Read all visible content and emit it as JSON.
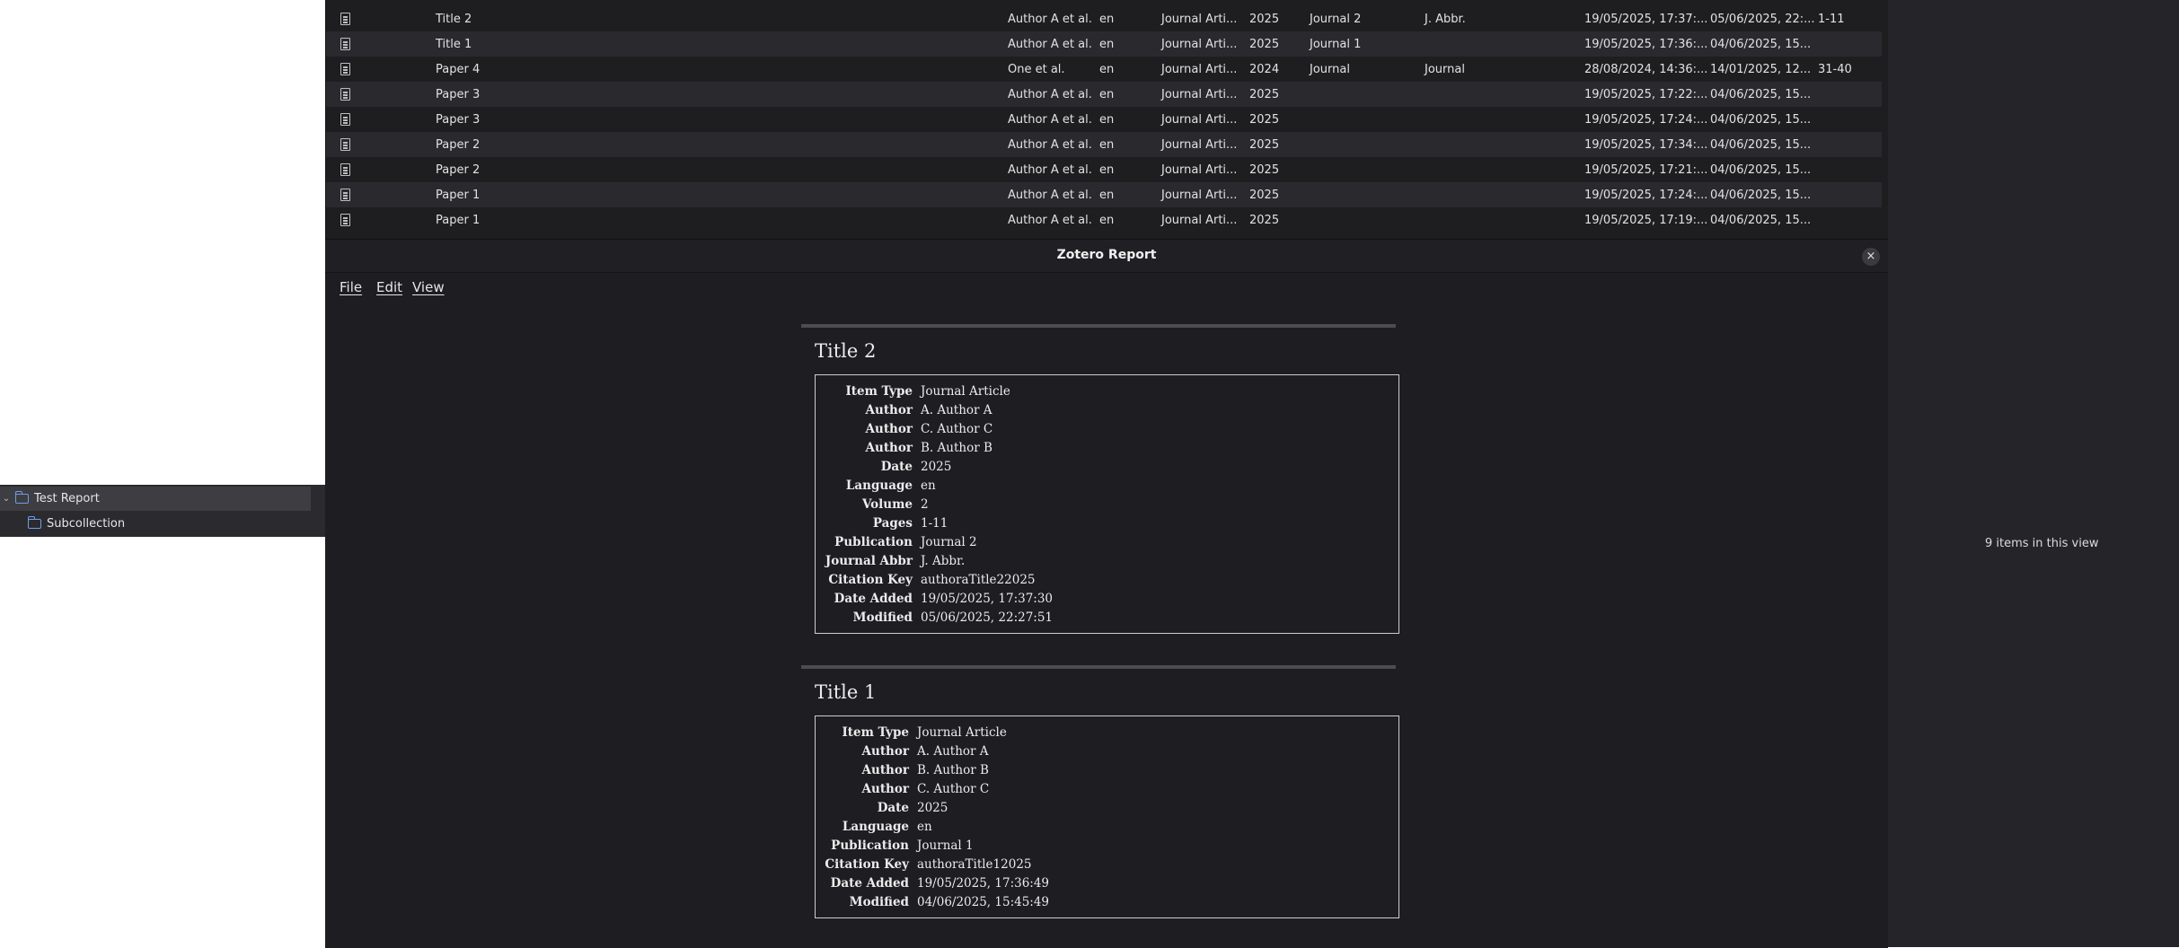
{
  "collections": [
    {
      "label": "Test Report",
      "expanded": true
    },
    {
      "label": "Subcollection"
    }
  ],
  "items": [
    {
      "title": "Title 2",
      "creator": "Author A et al.",
      "language": "en",
      "item_type": "Journal Arti...",
      "year": "2025",
      "publication": "Journal 2",
      "journal_abbr": "J. Abbr.",
      "date_added": "19/05/2025, 17:37:...",
      "modified": "05/06/2025, 22:...",
      "pages": "1-11"
    },
    {
      "title": "Title 1",
      "creator": "Author A et al.",
      "language": "en",
      "item_type": "Journal Arti...",
      "year": "2025",
      "publication": "Journal 1",
      "journal_abbr": "",
      "date_added": "19/05/2025, 17:36:...",
      "modified": "04/06/2025, 15...",
      "pages": ""
    },
    {
      "title": "Paper 4",
      "creator": "One et al.",
      "language": "en",
      "item_type": "Journal Arti...",
      "year": "2024",
      "publication": "Journal",
      "journal_abbr": "Journal",
      "date_added": "28/08/2024, 14:36:...",
      "modified": "14/01/2025, 12...",
      "pages": "31-40"
    },
    {
      "title": "Paper 3",
      "creator": "Author A et al.",
      "language": "en",
      "item_type": "Journal Arti...",
      "year": "2025",
      "publication": "",
      "journal_abbr": "",
      "date_added": "19/05/2025, 17:22:...",
      "modified": "04/06/2025, 15...",
      "pages": ""
    },
    {
      "title": "Paper 3",
      "creator": "Author A et al.",
      "language": "en",
      "item_type": "Journal Arti...",
      "year": "2025",
      "publication": "",
      "journal_abbr": "",
      "date_added": "19/05/2025, 17:24:...",
      "modified": "04/06/2025, 15...",
      "pages": ""
    },
    {
      "title": "Paper 2",
      "creator": "Author A et al.",
      "language": "en",
      "item_type": "Journal Arti...",
      "year": "2025",
      "publication": "",
      "journal_abbr": "",
      "date_added": "19/05/2025, 17:34:...",
      "modified": "04/06/2025, 15...",
      "pages": ""
    },
    {
      "title": "Paper 2",
      "creator": "Author A et al.",
      "language": "en",
      "item_type": "Journal Arti...",
      "year": "2025",
      "publication": "",
      "journal_abbr": "",
      "date_added": "19/05/2025, 17:21:...",
      "modified": "04/06/2025, 15...",
      "pages": ""
    },
    {
      "title": "Paper 1",
      "creator": "Author A et al.",
      "language": "en",
      "item_type": "Journal Arti...",
      "year": "2025",
      "publication": "",
      "journal_abbr": "",
      "date_added": "19/05/2025, 17:24:...",
      "modified": "04/06/2025, 15...",
      "pages": ""
    },
    {
      "title": "Paper 1",
      "creator": "Author A et al.",
      "language": "en",
      "item_type": "Journal Arti...",
      "year": "2025",
      "publication": "",
      "journal_abbr": "",
      "date_added": "19/05/2025, 17:19:...",
      "modified": "04/06/2025, 15...",
      "pages": ""
    }
  ],
  "item_pane": {
    "count_text": "9 items in this view"
  },
  "report_window": {
    "title": "Zotero Report",
    "close_icon": "×",
    "menu": [
      "File",
      "Edit",
      "View"
    ]
  },
  "report_items": [
    {
      "title": "Title 2",
      "fields": [
        {
          "label": "Item Type",
          "value": "Journal Article"
        },
        {
          "label": "Author",
          "value": "A. Author A"
        },
        {
          "label": "Author",
          "value": "C. Author C"
        },
        {
          "label": "Author",
          "value": "B. Author B"
        },
        {
          "label": "Date",
          "value": "2025"
        },
        {
          "label": "Language",
          "value": "en"
        },
        {
          "label": "Volume",
          "value": "2"
        },
        {
          "label": "Pages",
          "value": "1-11"
        },
        {
          "label": "Publication",
          "value": "Journal 2"
        },
        {
          "label": "Journal Abbr",
          "value": "J. Abbr."
        },
        {
          "label": "Citation Key",
          "value": "authoraTitle22025"
        },
        {
          "label": "Date Added",
          "value": "19/05/2025, 17:37:30"
        },
        {
          "label": "Modified",
          "value": "05/06/2025, 22:27:51"
        }
      ]
    },
    {
      "title": "Title 1",
      "fields": [
        {
          "label": "Item Type",
          "value": "Journal Article"
        },
        {
          "label": "Author",
          "value": "A. Author A"
        },
        {
          "label": "Author",
          "value": "B. Author B"
        },
        {
          "label": "Author",
          "value": "C. Author C"
        },
        {
          "label": "Date",
          "value": "2025"
        },
        {
          "label": "Language",
          "value": "en"
        },
        {
          "label": "Publication",
          "value": "Journal 1"
        },
        {
          "label": "Citation Key",
          "value": "authoraTitle12025"
        },
        {
          "label": "Date Added",
          "value": "19/05/2025, 17:36:49"
        },
        {
          "label": "Modified",
          "value": "04/06/2025, 15:45:49"
        }
      ]
    }
  ]
}
